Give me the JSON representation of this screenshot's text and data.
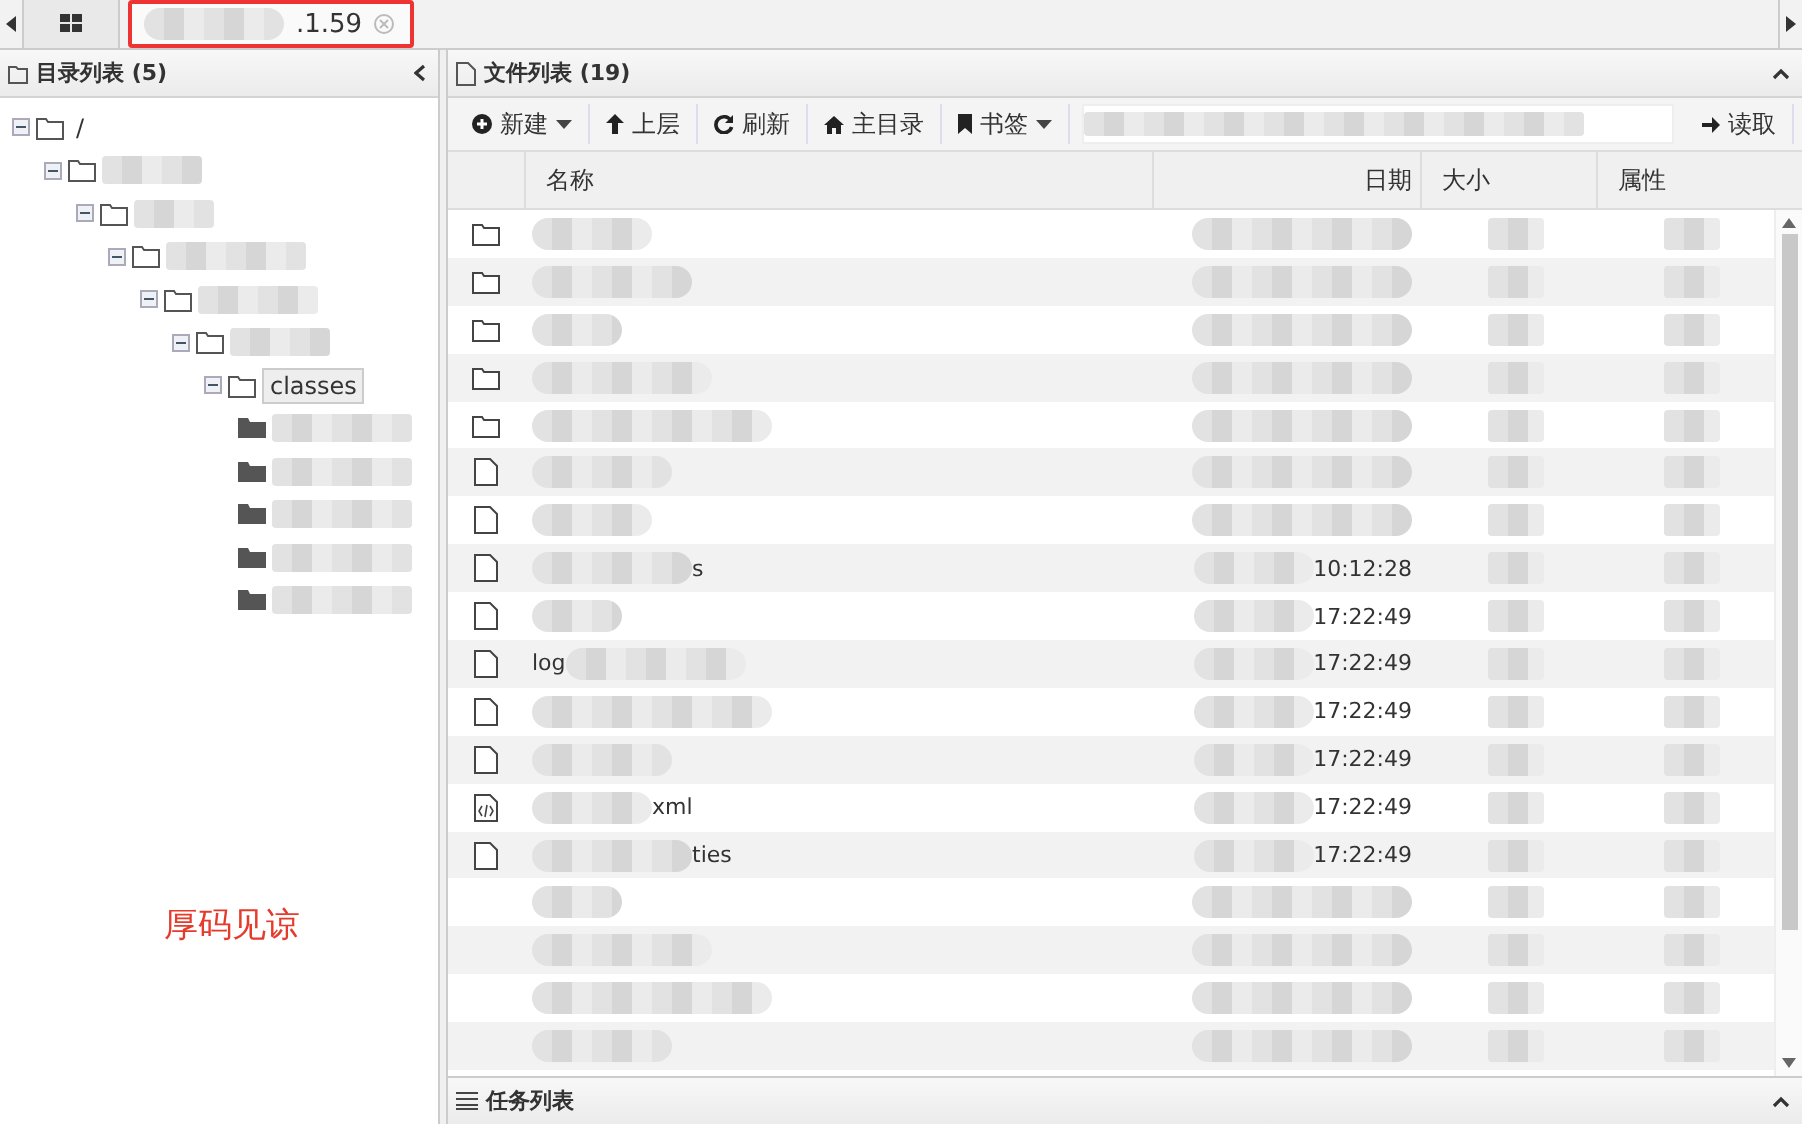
{
  "tabs": [
    {
      "kind": "home",
      "selected": false
    },
    {
      "kind": "session",
      "label": ".1.59",
      "selected": true
    }
  ],
  "directory_panel": {
    "title": "目录列表 (5)",
    "tree": [
      {
        "name": "/",
        "redacted": false,
        "children": [
          {
            "redacted": true,
            "children": [
              {
                "redacted": true,
                "children": [
                  {
                    "redacted": true,
                    "children": [
                      {
                        "redacted": true,
                        "children": [
                          {
                            "redacted": true,
                            "children": [
                              {
                                "name": "classes",
                                "redacted": false,
                                "selected": true,
                                "children": [
                                  {
                                    "redacted": true,
                                    "closed": true
                                  },
                                  {
                                    "redacted": true,
                                    "closed": true
                                  },
                                  {
                                    "redacted": true,
                                    "closed": true
                                  },
                                  {
                                    "redacted": true,
                                    "closed": true
                                  },
                                  {
                                    "redacted": true,
                                    "closed": true
                                  }
                                ]
                              }
                            ]
                          }
                        ]
                      }
                    ]
                  }
                ]
              }
            ]
          }
        ]
      }
    ]
  },
  "annotation": "厚码见谅",
  "file_panel": {
    "title": "文件列表 (19)",
    "toolbar": [
      {
        "label": "新建",
        "dropdown": true
      },
      {
        "label": "上层",
        "dropdown": false
      },
      {
        "label": "刷新",
        "dropdown": false
      },
      {
        "label": "主目录",
        "dropdown": false
      },
      {
        "label": "书签",
        "dropdown": true
      }
    ],
    "read_button": "读取",
    "columns": [
      "名称",
      "日期",
      "大小",
      "属性"
    ],
    "rows": [
      {
        "kind": "folder"
      },
      {
        "kind": "folder"
      },
      {
        "kind": "folder"
      },
      {
        "kind": "folder"
      },
      {
        "kind": "folder"
      },
      {
        "kind": "file"
      },
      {
        "kind": "file"
      },
      {
        "kind": "file",
        "name_suffix": "s",
        "date": "10:12:28"
      },
      {
        "kind": "file",
        "date": "17:22:49"
      },
      {
        "kind": "file",
        "name_prefix": "log",
        "date": "17:22:49"
      },
      {
        "kind": "file",
        "date": "17:22:49"
      },
      {
        "kind": "file",
        "date": "17:22:49"
      },
      {
        "kind": "code",
        "name_suffix": "xml",
        "date": "17:22:49"
      },
      {
        "kind": "file",
        "name_suffix": "ties",
        "date": "17:22:49"
      },
      {
        "kind": "hidden"
      },
      {
        "kind": "hidden"
      },
      {
        "kind": "hidden"
      },
      {
        "kind": "hidden"
      }
    ]
  },
  "task_panel": {
    "title": "任务列表"
  }
}
